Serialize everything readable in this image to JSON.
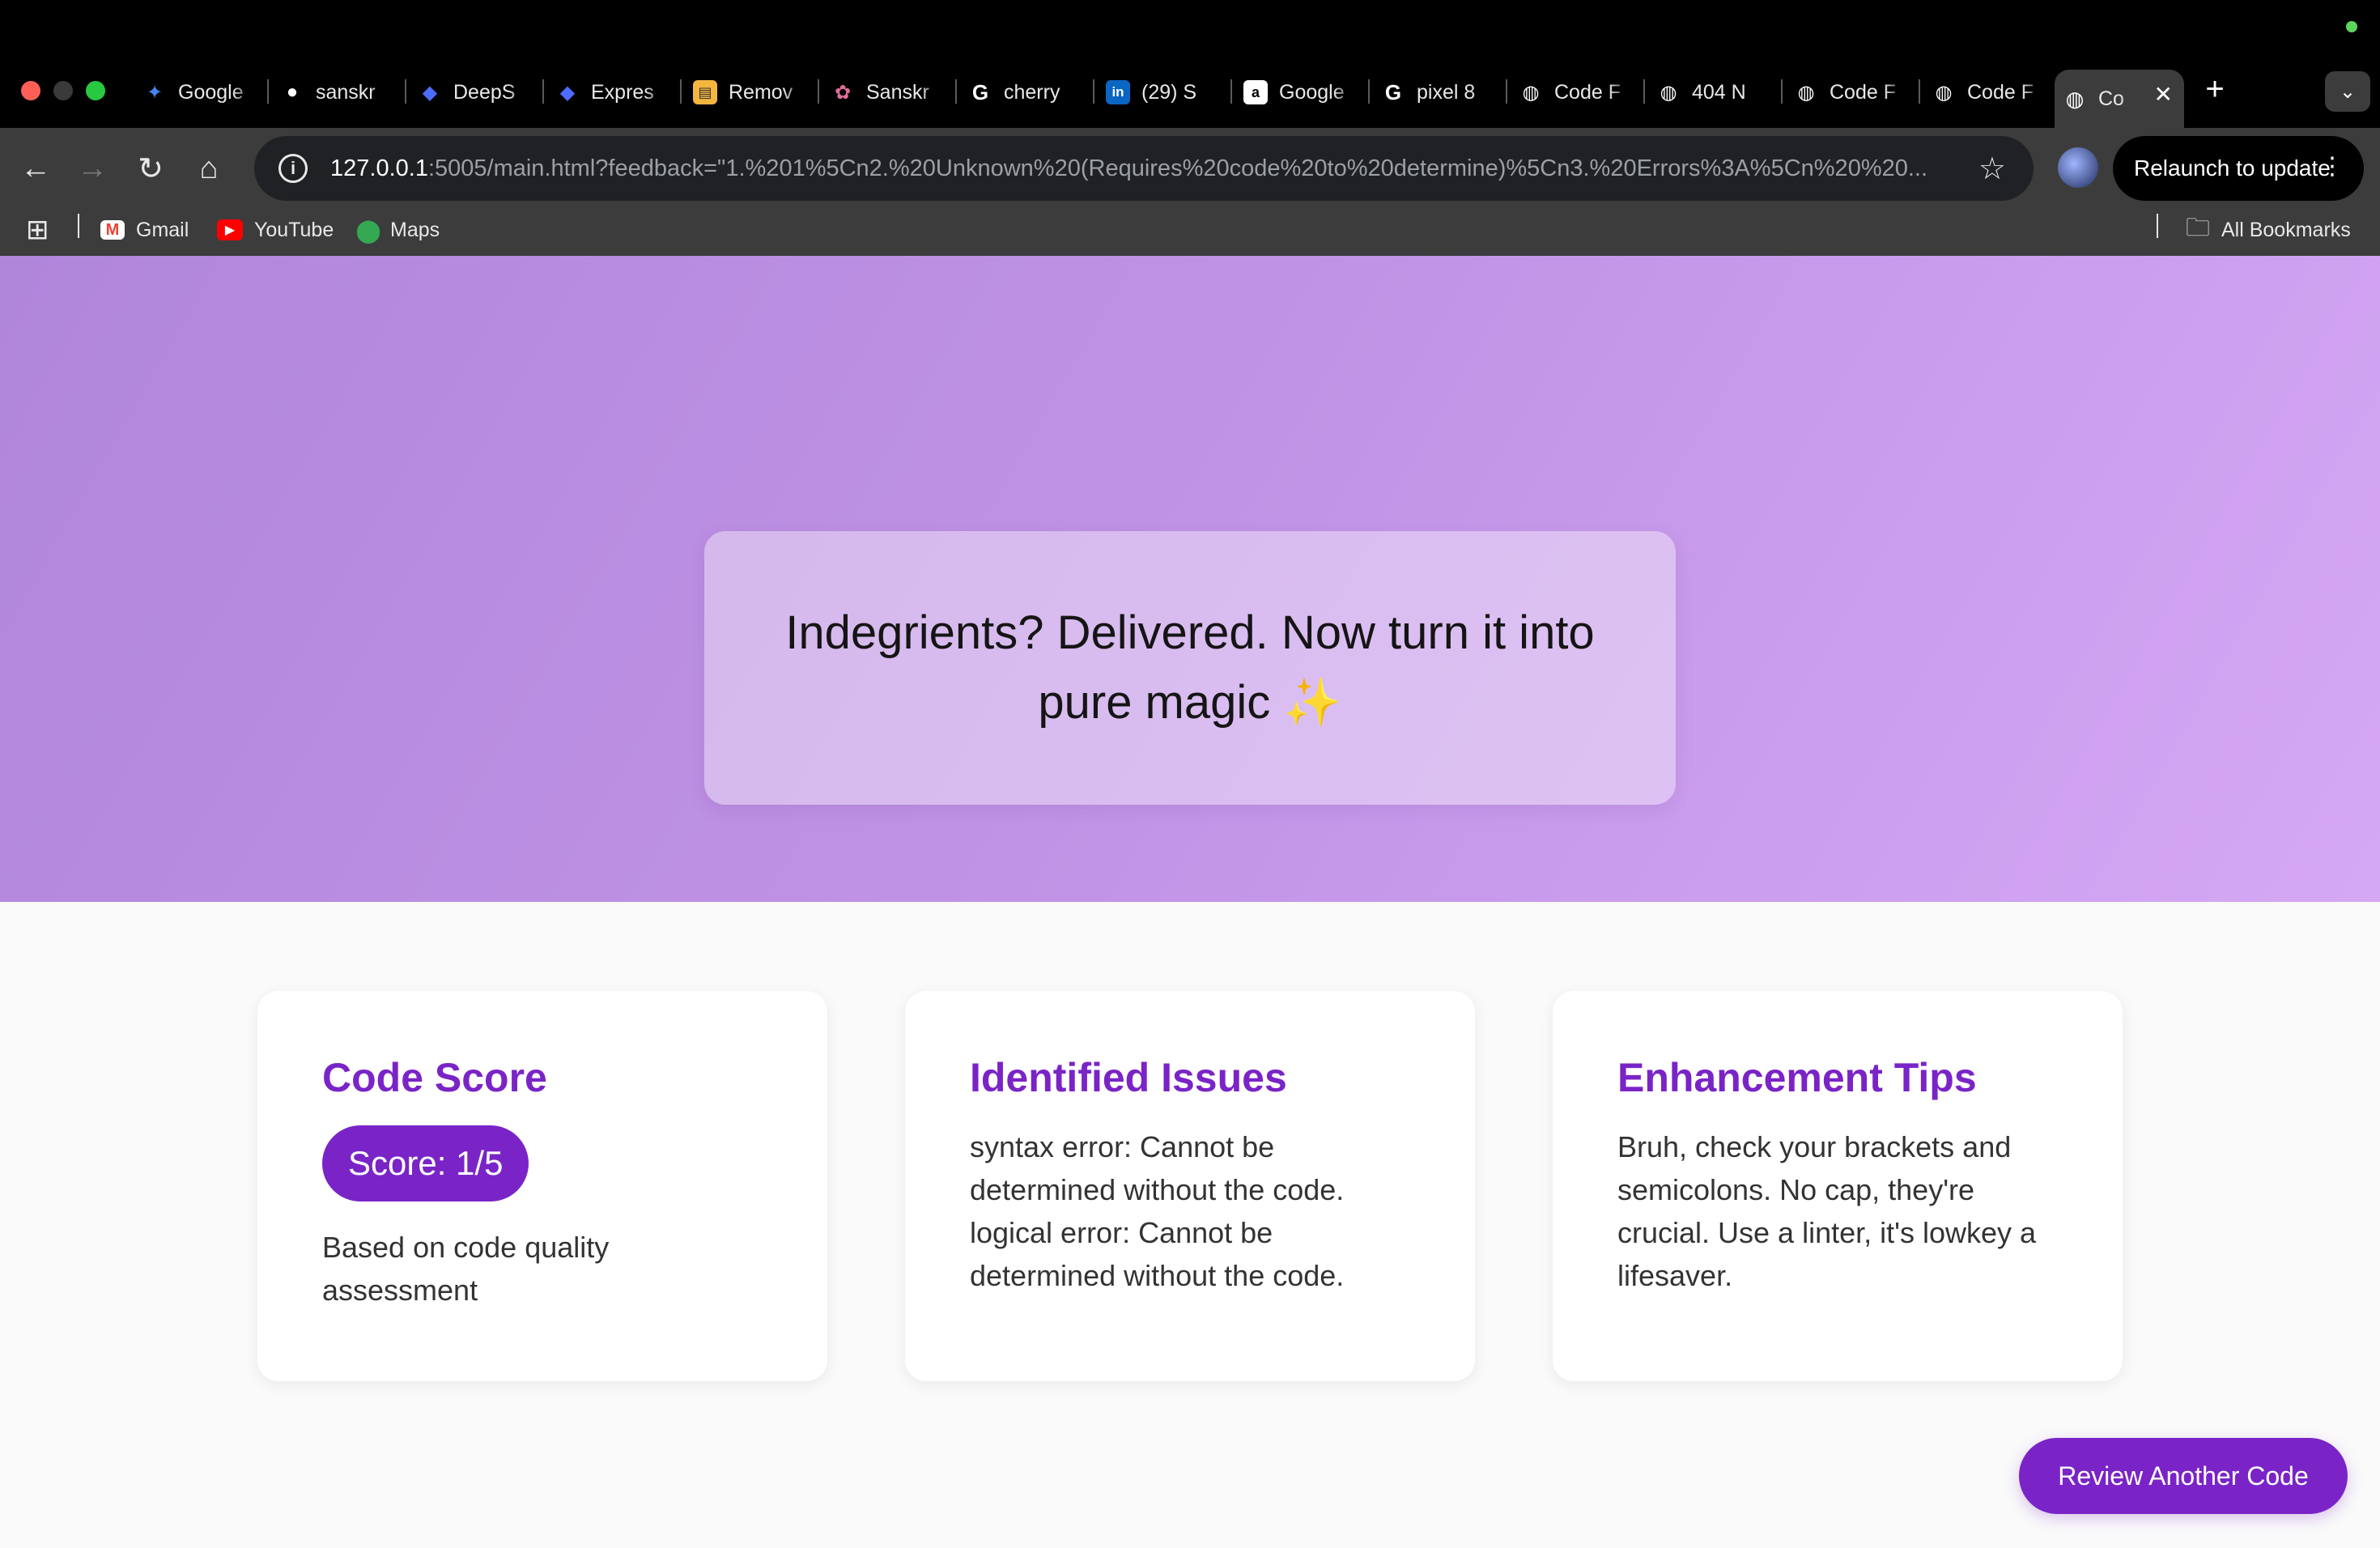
{
  "browser": {
    "tabs": [
      {
        "label": "Google",
        "icon": "gemini-icon",
        "color": "#4285f4"
      },
      {
        "label": "sanskr",
        "icon": "github-icon",
        "color": "#ffffff"
      },
      {
        "label": "DeepS",
        "icon": "deepseek-icon",
        "color": "#4d6bfe"
      },
      {
        "label": "Expres",
        "icon": "deepseek-icon",
        "color": "#4d6bfe"
      },
      {
        "label": "Remov",
        "icon": "remove-bg-icon",
        "color": "#f4b63f"
      },
      {
        "label": "Sanskr",
        "icon": "flower-icon",
        "color": "#e06e9a"
      },
      {
        "label": "cherry",
        "icon": "google-icon",
        "color": "#ffffff"
      },
      {
        "label": "(29) S",
        "icon": "linkedin-icon",
        "color": "#0a66c2"
      },
      {
        "label": "Google",
        "icon": "amazon-icon",
        "color": "#ffffff"
      },
      {
        "label": "pixel 8",
        "icon": "google-icon",
        "color": "#ffffff"
      },
      {
        "label": "Code F",
        "icon": "globe-icon",
        "color": "#ffffff"
      },
      {
        "label": "404 N",
        "icon": "globe-icon",
        "color": "#ffffff"
      },
      {
        "label": "Code F",
        "icon": "globe-icon",
        "color": "#ffffff"
      },
      {
        "label": "Code F",
        "icon": "globe-icon",
        "color": "#ffffff"
      }
    ],
    "active_tab": {
      "label": "Co",
      "icon": "globe-icon"
    },
    "url_host": "127.0.0.1",
    "url_rest": ":5005/main.html?feedback=\"1.%201%5Cn2.%20Unknown%20(Requires%20code%20to%20determine)%5Cn3.%20Errors%3A%5Cn%20%20...",
    "relaunch_label": "Relaunch to update",
    "bookmarks": [
      {
        "label": "Gmail",
        "icon": "gmail-icon"
      },
      {
        "label": "YouTube",
        "icon": "youtube-icon"
      },
      {
        "label": "Maps",
        "icon": "maps-icon"
      }
    ],
    "all_bookmarks_label": "All Bookmarks"
  },
  "hero": {
    "text": "Indegrients? Delivered. Now turn it into pure magic",
    "emoji": "✨"
  },
  "cards": {
    "score": {
      "title": "Code Score",
      "pill": "Score: 1/5",
      "caption": "Based on code quality assessment"
    },
    "issues": {
      "title": "Identified Issues",
      "line1": "syntax error: Cannot be determined without the code.",
      "line2": "logical error: Cannot be determined without the code."
    },
    "tips": {
      "title": "Enhancement Tips",
      "body": "Bruh, check your brackets and semicolons. No cap, they're crucial. Use a linter, it's lowkey a lifesaver."
    }
  },
  "actions": {
    "review_label": "Review Another Code"
  },
  "colors": {
    "accent": "#7a24c7",
    "hero_start": "#b086db",
    "hero_end": "#d5a8f5"
  }
}
